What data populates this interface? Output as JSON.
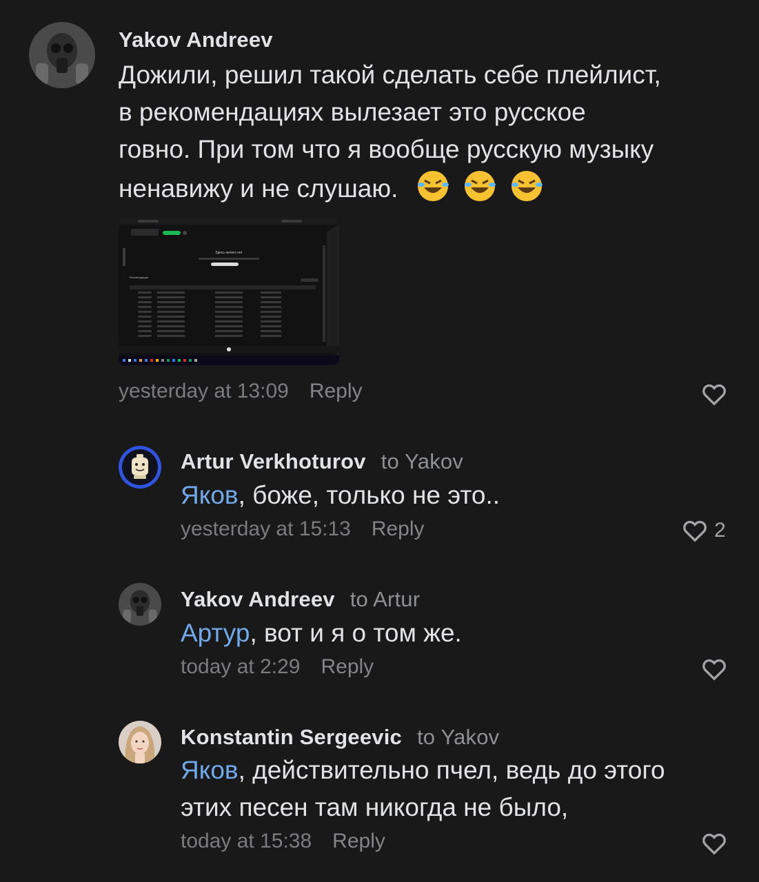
{
  "comments": [
    {
      "author": "Yakov Andreev",
      "to": "",
      "mention": "",
      "text_lines": [
        "Дожили, решил такой сделать себе плейлист,",
        "в рекомендациях вылезает это русское",
        "говно. При том что я вообще русскую музыку",
        "ненавижу и не слушаю."
      ],
      "emoji": [
        "rolling-on-floor-laughing",
        "rolling-on-floor-laughing",
        "rolling-on-floor-laughing"
      ],
      "attachment": {
        "type": "screenshot",
        "heading": "Здесь ничего нет",
        "section": "Рекомендации"
      },
      "time": "yesterday at 13:09",
      "reply": "Reply",
      "likes": ""
    },
    {
      "author": "Artur Verkhoturov",
      "to": "to Yakov",
      "mention": "Яков",
      "text": ", боже, только не это..",
      "time": "yesterday at 15:13",
      "reply": "Reply",
      "likes": "2"
    },
    {
      "author": "Yakov Andreev",
      "to": "to Artur",
      "mention": "Артур",
      "text": ", вот и я о том же.",
      "time": "today at 2:29",
      "reply": "Reply",
      "likes": ""
    },
    {
      "author": "Konstantin Sergeevic",
      "to": "to Yakov",
      "mention": "Яков",
      "text_line1": ", действительно пчел, ведь до этого",
      "text_line2": "этих песен там никогда не было,",
      "time": "today at 15:38",
      "reply": "Reply",
      "likes": ""
    }
  ],
  "icons": {
    "like": "heart-outline-icon"
  },
  "colors": {
    "background": "#19191a",
    "text": "#e1e3e6",
    "mention": "#71aaeb",
    "meta": "#7a7c80"
  }
}
